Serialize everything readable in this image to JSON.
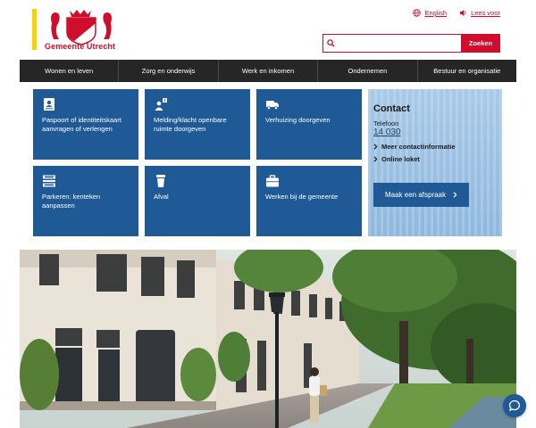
{
  "brand": {
    "name": "Gemeente Utrecht",
    "logo_icon": "utrecht-coat-of-arms-icon",
    "accent": "#d00d2d",
    "bar_color": "#f5d400",
    "tile_color": "#1f5a96"
  },
  "toplinks": {
    "english_label": "English",
    "english_icon": "globe-icon",
    "read_label": "Lees voor",
    "read_icon": "speaker-icon"
  },
  "search": {
    "value": "",
    "placeholder": "",
    "button_label": "Zoeken"
  },
  "nav": {
    "items": [
      {
        "label": "Wonen en leven"
      },
      {
        "label": "Zorg en onderwijs"
      },
      {
        "label": "Werk en inkomen"
      },
      {
        "label": "Ondernemen"
      },
      {
        "label": "Bestuur en organisatie"
      }
    ]
  },
  "tiles": [
    {
      "label": "Paspoort of identiteitskaart aanvragen of verlengen",
      "icon": "passport-icon"
    },
    {
      "label": "Melding/klacht openbare ruimte doorgeven",
      "icon": "report-person-icon"
    },
    {
      "label": "Verhuizing doorgeven",
      "icon": "moving-truck-icon"
    },
    {
      "label": "Parkeren: kenteken aanpassen",
      "icon": "parking-sign-icon"
    },
    {
      "label": "Afval",
      "icon": "waste-bin-icon"
    },
    {
      "label": "Werken bij de gemeente",
      "icon": "briefcase-icon"
    }
  ],
  "contact": {
    "title": "Contact",
    "phone_label": "Telefoon",
    "phone_number": "14 030",
    "more_info_label": "Meer contactinformatie",
    "online_label": "Online loket",
    "appointment_label": "Maak een afspraak"
  },
  "hero": {
    "description_icon": "city-street-photo"
  },
  "chat": {
    "icon": "chat-bubble-icon"
  }
}
